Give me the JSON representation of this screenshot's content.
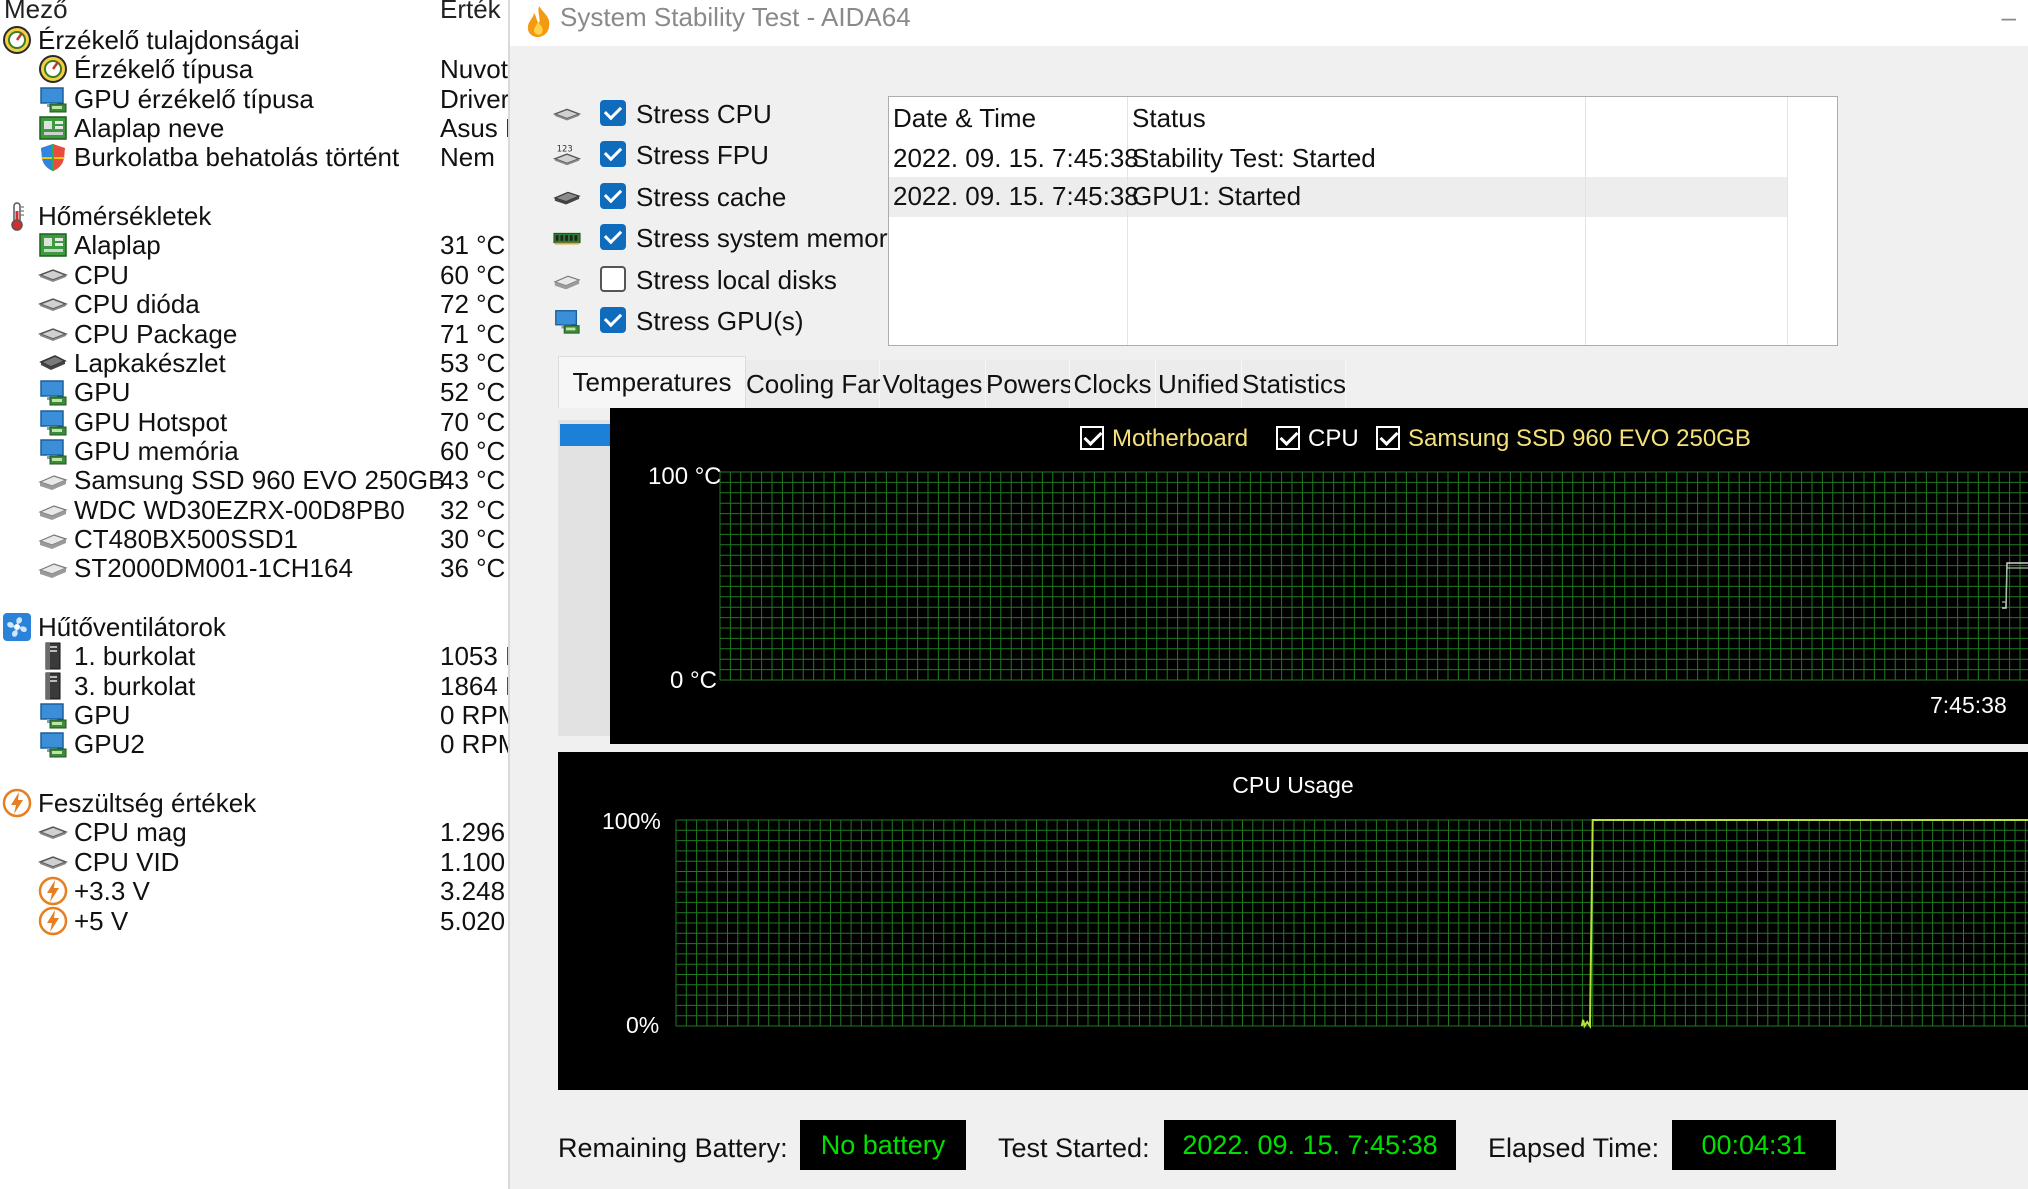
{
  "left_panel": {
    "headers": {
      "field": "Mező",
      "value": "Érték"
    },
    "rows": [
      {
        "label": "Érzékelő tulajdonságai",
        "value": "",
        "icon": "gauge-icon",
        "indent": 0
      },
      {
        "label": "Érzékelő típusa",
        "value": "Nuvot",
        "icon": "gauge-icon",
        "indent": 1
      },
      {
        "label": "GPU érzékelő típusa",
        "value": "Driver",
        "icon": "monitor-icon",
        "indent": 1
      },
      {
        "label": "Alaplap neve",
        "value": "Asus F",
        "icon": "motherboard-icon",
        "indent": 1
      },
      {
        "label": "Burkolatba behatolás történt",
        "value": "Nem",
        "icon": "shield-icon",
        "indent": 1
      },
      {
        "label": "Hőmérsékletek",
        "value": "",
        "icon": "thermometer-icon",
        "indent": 0
      },
      {
        "label": "Alaplap",
        "value": "31 °C",
        "icon": "motherboard-icon",
        "indent": 1
      },
      {
        "label": "CPU",
        "value": "60 °C",
        "icon": "cpu-icon",
        "indent": 1
      },
      {
        "label": "CPU dióda",
        "value": "72 °C",
        "icon": "cpu-icon",
        "indent": 1
      },
      {
        "label": "CPU Package",
        "value": "71 °C",
        "icon": "cpu-icon",
        "indent": 1
      },
      {
        "label": "Lapkakészlet",
        "value": "53 °C",
        "icon": "chip-icon",
        "indent": 1
      },
      {
        "label": "GPU",
        "value": "52 °C",
        "icon": "monitor-icon",
        "indent": 1
      },
      {
        "label": "GPU Hotspot",
        "value": "70 °C",
        "icon": "monitor-icon",
        "indent": 1
      },
      {
        "label": "GPU memória",
        "value": "60 °C",
        "icon": "monitor-icon",
        "indent": 1
      },
      {
        "label": "Samsung SSD 960 EVO 250GB",
        "value": "43 °C",
        "icon": "disk-icon",
        "indent": 1
      },
      {
        "label": "WDC WD30EZRX-00D8PB0",
        "value": "32 °C",
        "icon": "disk-icon",
        "indent": 1
      },
      {
        "label": "CT480BX500SSD1",
        "value": "30 °C",
        "icon": "disk-icon",
        "indent": 1
      },
      {
        "label": "ST2000DM001-1CH164",
        "value": "36 °C",
        "icon": "disk-icon",
        "indent": 1
      },
      {
        "label": "Hűtőventilátorok",
        "value": "",
        "icon": "fan-icon",
        "indent": 0
      },
      {
        "label": "1. burkolat",
        "value": "1053 F",
        "icon": "case-icon",
        "indent": 1
      },
      {
        "label": "3. burkolat",
        "value": "1864 F",
        "icon": "case-icon",
        "indent": 1
      },
      {
        "label": "GPU",
        "value": "0 RPM",
        "icon": "monitor-icon",
        "indent": 1
      },
      {
        "label": "GPU2",
        "value": "0 RPM",
        "icon": "monitor-icon",
        "indent": 1
      },
      {
        "label": "Feszültség értékek",
        "value": "",
        "icon": "voltage-icon",
        "indent": 0
      },
      {
        "label": "CPU mag",
        "value": "1.296",
        "icon": "cpu-icon",
        "indent": 1
      },
      {
        "label": "CPU VID",
        "value": "1.100",
        "icon": "cpu-icon",
        "indent": 1
      },
      {
        "label": "+3.3 V",
        "value": "3.248",
        "icon": "voltage-icon",
        "indent": 1
      },
      {
        "label": "+5 V",
        "value": "5.020",
        "icon": "voltage-icon",
        "indent": 1
      }
    ]
  },
  "window": {
    "title": "System Stability Test - AIDA64",
    "minimize_glyph": "–",
    "stress_options": [
      {
        "label": "Stress CPU",
        "checked": true,
        "icon": "cpu-icon"
      },
      {
        "label": "Stress FPU",
        "checked": true,
        "icon": "fpu-icon"
      },
      {
        "label": "Stress cache",
        "checked": true,
        "icon": "cache-icon"
      },
      {
        "label": "Stress system memory",
        "checked": true,
        "icon": "memory-icon"
      },
      {
        "label": "Stress local disks",
        "checked": false,
        "icon": "disk-icon"
      },
      {
        "label": "Stress GPU(s)",
        "checked": true,
        "icon": "monitor-icon"
      }
    ],
    "log": {
      "columns": [
        "Date & Time",
        "Status"
      ],
      "rows": [
        [
          "2022. 09. 15. 7:45:38",
          "Stability Test: Started"
        ],
        [
          "2022. 09. 15. 7:45:38",
          "GPU1: Started"
        ]
      ]
    },
    "tabs": [
      "Temperatures",
      "Cooling Fans",
      "Voltages",
      "Powers",
      "Clocks",
      "Unified",
      "Statistics"
    ],
    "active_tab": "Temperatures",
    "status_bar": {
      "battery_label": "Remaining Battery:",
      "battery_value": "No battery",
      "started_label": "Test Started:",
      "started_value": "2022. 09. 15. 7:45:38",
      "elapsed_label": "Elapsed Time:",
      "elapsed_value": "00:04:31"
    }
  },
  "chart_data": [
    {
      "type": "line",
      "legend": [
        {
          "name": "Motherboard",
          "checked": true,
          "color": "#f5e17a"
        },
        {
          "name": "CPU",
          "checked": true,
          "color": "#ffffff"
        },
        {
          "name": "Samsung SSD 960 EVO 250GB",
          "checked": true,
          "color": "#f5e17a"
        }
      ],
      "y_max_label": "100 °C",
      "y_min_label": "0 °C",
      "ylim": [
        0,
        100
      ],
      "x_tick_label": "7:45:38",
      "grid": true,
      "grid_color": "#1f7a1f",
      "series": []
    },
    {
      "type": "line",
      "title": "CPU Usage",
      "y_max_label": "100%",
      "y_min_label": "0%",
      "ylim": [
        0,
        100
      ],
      "grid": true,
      "grid_color": "#1f7a1f",
      "line_color": "#b7e23c",
      "series": [
        {
          "values": [
            {
              "t": 0.0,
              "y": 0
            },
            {
              "t": 0.67,
              "y": 0
            },
            {
              "t": 0.671,
              "y": 3
            },
            {
              "t": 0.672,
              "y": 0
            },
            {
              "t": 0.674,
              "y": 2
            },
            {
              "t": 0.676,
              "y": 0
            },
            {
              "t": 0.678,
              "y": 100
            },
            {
              "t": 1.0,
              "y": 100
            }
          ]
        }
      ]
    }
  ]
}
